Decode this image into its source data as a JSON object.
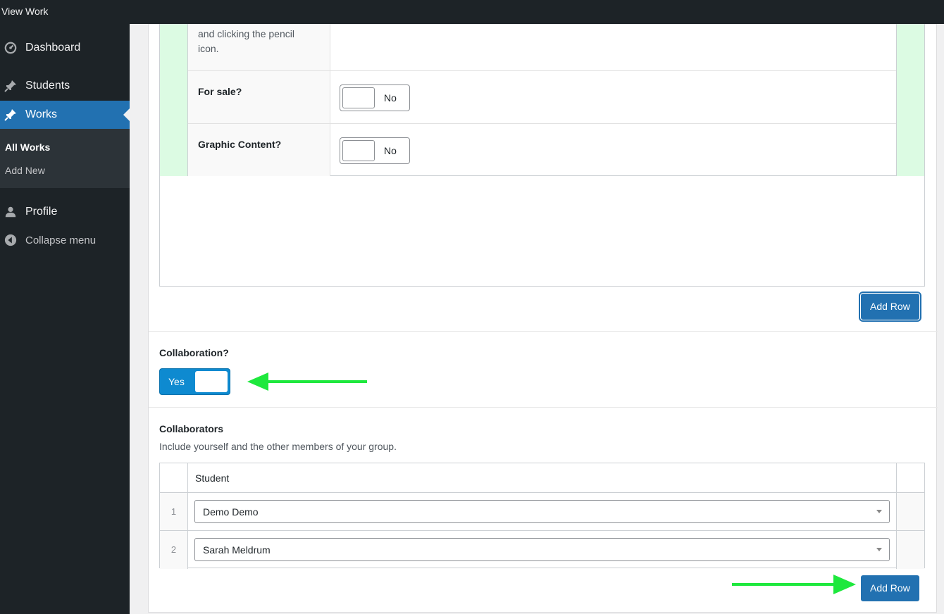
{
  "topbar": {
    "title": "View Work"
  },
  "sidebar": {
    "items": [
      {
        "label": "Dashboard",
        "icon": "dashboard-icon"
      },
      {
        "label": "Students",
        "icon": "pin-icon"
      },
      {
        "label": "Works",
        "icon": "pin-icon"
      }
    ],
    "submenu": [
      {
        "label": "All Works"
      },
      {
        "label": "Add New"
      }
    ],
    "profile": {
      "label": "Profile",
      "icon": "user-icon"
    },
    "collapse": {
      "label": "Collapse menu",
      "icon": "collapse-icon"
    }
  },
  "top_table": {
    "desc_text": "and clicking the pencil icon.",
    "rows": [
      {
        "label": "For sale?",
        "toggle": "No"
      },
      {
        "label": "Graphic Content?",
        "toggle": "No"
      }
    ],
    "add_row_label": "Add Row"
  },
  "collaboration": {
    "label": "Collaboration?",
    "toggle": "Yes"
  },
  "collaborators": {
    "label": "Collaborators",
    "description": "Include yourself and the other members of your group.",
    "column_header": "Student",
    "rows": [
      {
        "num": "1",
        "value": "Demo Demo"
      },
      {
        "num": "2",
        "value": "Sarah Meldrum"
      }
    ],
    "add_row_label": "Add Row"
  },
  "colors": {
    "admin_dark": "#1d2327",
    "accent_blue": "#2271b1",
    "toggle_on": "#0e8ad0",
    "annotation_green": "#1ee83d",
    "row_highlight": "#dcfbe3"
  }
}
